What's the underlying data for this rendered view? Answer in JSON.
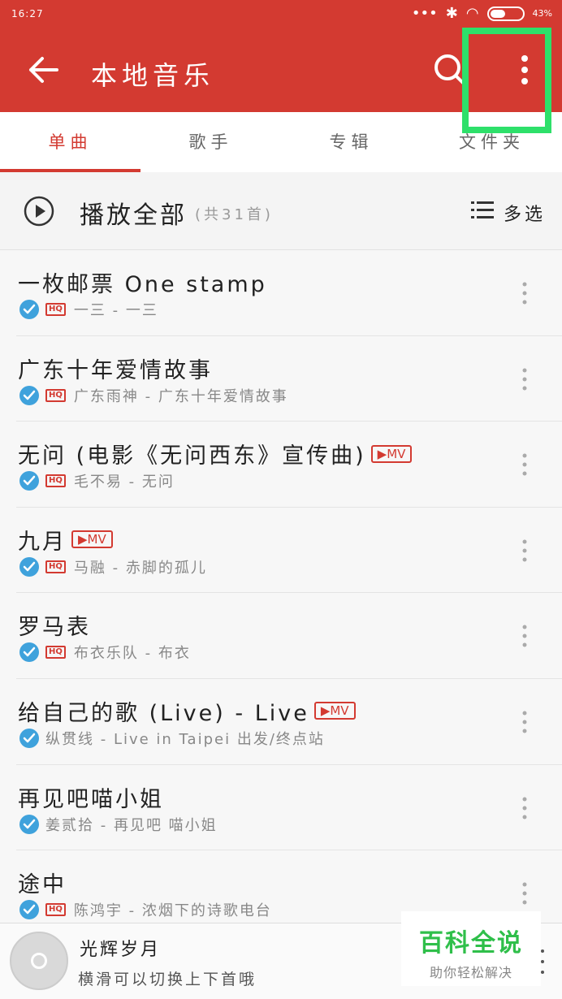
{
  "status_bar": {
    "time": "16:27",
    "battery": "43%"
  },
  "header": {
    "title": "本地音乐"
  },
  "tabs": [
    {
      "label": "单曲",
      "active": true
    },
    {
      "label": "歌手",
      "active": false
    },
    {
      "label": "专辑",
      "active": false
    },
    {
      "label": "文件夹",
      "active": false
    }
  ],
  "playall": {
    "label": "播放全部",
    "count": "(共31首)",
    "multi_select": "多选"
  },
  "songs": [
    {
      "title": "一枚邮票 One stamp",
      "hq": true,
      "mv": false,
      "subtitle": "一三 - 一三"
    },
    {
      "title": "广东十年爱情故事",
      "hq": true,
      "mv": false,
      "subtitle": "广东雨神 - 广东十年爱情故事"
    },
    {
      "title": "无问 (电影《无问西东》宣传曲)",
      "hq": true,
      "mv": true,
      "subtitle": "毛不易 - 无问"
    },
    {
      "title": "九月",
      "hq": true,
      "mv": true,
      "subtitle": "马融 - 赤脚的孤儿"
    },
    {
      "title": "罗马表",
      "hq": true,
      "mv": false,
      "subtitle": "布衣乐队 - 布衣"
    },
    {
      "title": "给自己的歌 (Live) - Live",
      "hq": false,
      "mv": true,
      "subtitle": "纵贯线 - Live in Taipei 出发/终点站"
    },
    {
      "title": "再见吧喵小姐",
      "hq": false,
      "mv": false,
      "subtitle": "姜贰拾 - 再见吧 喵小姐"
    },
    {
      "title": "途中",
      "hq": true,
      "mv": false,
      "subtitle": "陈鸿宇 - 浓烟下的诗歌电台"
    }
  ],
  "badges": {
    "hq": "HQ",
    "mv": "▶MV"
  },
  "player": {
    "title": "光辉岁月",
    "hint": "横滑可以切换上下首哦"
  },
  "watermark": {
    "title": "百科全说",
    "subtitle": "助你轻松解决"
  },
  "colors": {
    "primary": "#d33a31",
    "check": "#3fa2dc",
    "highlight": "#2ee06a",
    "watermark": "#2fbf4a"
  }
}
